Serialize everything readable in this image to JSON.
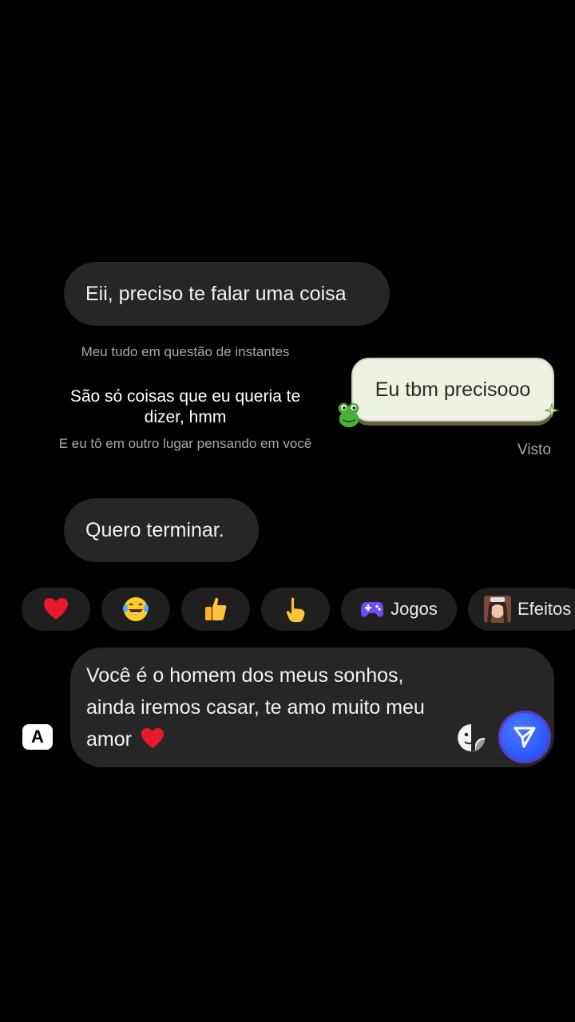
{
  "messages": {
    "received_1": "Eii, preciso te falar uma coisa",
    "sent_1": "Eu tbm precisooo",
    "received_2": "Quero terminar.",
    "seen_label": "Visto"
  },
  "lyrics": {
    "line_prev": "Meu tudo em questão de instantes",
    "line_current": "São só coisas que eu queria te dizer, hmm",
    "line_next": "E eu tô em outro lugar pensando em você"
  },
  "reactions": {
    "items": [
      {
        "icon": "heart-emoji"
      },
      {
        "icon": "laughing-tears-emoji"
      },
      {
        "icon": "thumbs-up-emoji"
      },
      {
        "icon": "pointing-hand-emoji"
      }
    ],
    "games_label": "Jogos",
    "effects_label": "Efeitos"
  },
  "composer": {
    "text": "Você é o homem dos meus sonhos, ainda iremos casar, te amo muito meu amor",
    "trailing_emoji": "heart-emoji"
  },
  "keyboard_switch_label": "A",
  "colors": {
    "background": "#000000",
    "bubble_received": "#262626",
    "bubble_sent": "#eef2e2",
    "send_button": "#2f5bff"
  }
}
